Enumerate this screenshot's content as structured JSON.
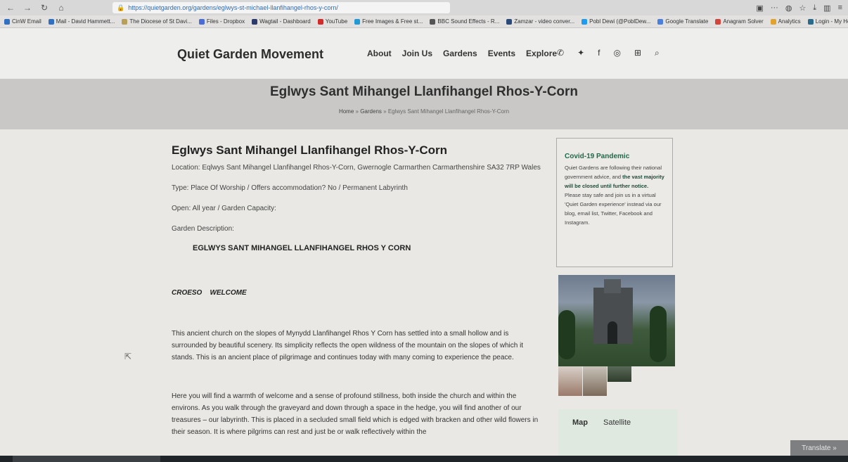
{
  "browser": {
    "url": "https://quietgarden.org/gardens/eglwys-st-michael-llanfihangel-rhos-y-corn/",
    "bookmarks": [
      "CinW Email",
      "Mail - David Hammett...",
      "The Diocese of St Davi...",
      "Files - Dropbox",
      "Wagtail - Dashboard",
      "YouTube",
      "Free Images & Free st...",
      "BBC Sound Effects - R...",
      "Zamzar - video conver...",
      "Pobl Dewi (@PoblDew...",
      "Google Translate",
      "Anagram Solver",
      "Analytics",
      "Login - My Health Onl..."
    ],
    "bookmark_colors": [
      "#2f6fc4",
      "#2f6fc4",
      "#b8a05a",
      "#4a6bd8",
      "#2b3a6a",
      "#d42a2a",
      "#1f9ad6",
      "#555555",
      "#2a4a7a",
      "#1d9bf0",
      "#4a7fe0",
      "#d4443a",
      "#e3a32a",
      "#2a6a8a"
    ]
  },
  "site": {
    "logo": "Quiet Garden Movement",
    "nav": [
      "About",
      "Join Us",
      "Gardens",
      "Events",
      "Explore"
    ],
    "nav_icons": [
      "phone-icon",
      "twitter-icon",
      "facebook-icon",
      "instagram-icon",
      "cart-icon",
      "search-icon"
    ]
  },
  "banner": {
    "title": "Eglwys Sant Mihangel Llanfihangel Rhos-Y-Corn",
    "breadcrumb": {
      "home": "Home",
      "sep": "»",
      "gardens": "Gardens",
      "current": "Eglwys Sant Mihangel Llanfihangel Rhos-Y-Corn"
    }
  },
  "garden": {
    "title": "Eglwys Sant Mihangel Llanfihangel Rhos-Y-Corn",
    "location": "Location: Eqlwys Sant Mihangel Llanfihangel Rhos-Y-Corn, Gwernogle Carmarthen Carmarthenshire SA32 7RP Wales",
    "type": "Type: Place Of Worship  /  Offers accommodation? No  /  Permanent Labyrinth",
    "open": "Open: All year  /  Garden Capacity:",
    "description_label": "Garden Description:",
    "heading": "EGLWYS SANT MIHANGEL LLANFIHANGEL RHOS Y CORN",
    "welcome": "CROESO    WELCOME",
    "paragraph1": "This ancient church on the slopes of Mynydd Llanfihangel Rhos Y Corn has settled into a small hollow and is surrounded by beautiful scenery. Its simplicity reflects the open wildness of the mountain on the slopes of which it stands. This is an ancient place of pilgrimage and continues today with many coming to experience the peace.",
    "paragraph2": "Here you will find a warmth of welcome and a sense of profound stillness, both inside the church and within the environs. As you walk through the graveyard and down through a space in the hedge, you will find another of our treasures – our labyrinth. This is placed in a secluded small field which is edged with bracken and other wild flowers in their season. It is where pilgrims can rest and just be or walk reflectively within the"
  },
  "sidebar": {
    "covid_title": "Covid-19 Pandemic",
    "covid_text_1": "Quiet Gardens are following their national government advice, and ",
    "covid_text_bold": "the vast majority will be closed until further notice.",
    "covid_text_2": " Please stay safe and join us in a virtual 'Quiet Garden experience' instead via our blog, email list, Twitter, Facebook and Instagram.",
    "map_tabs": [
      "Map",
      "Satellite"
    ]
  },
  "translate_button": "Translate »",
  "colors": {
    "accent_green": "#1e6a4a",
    "band": "#c9c8c6",
    "header": "#eeeeec"
  }
}
